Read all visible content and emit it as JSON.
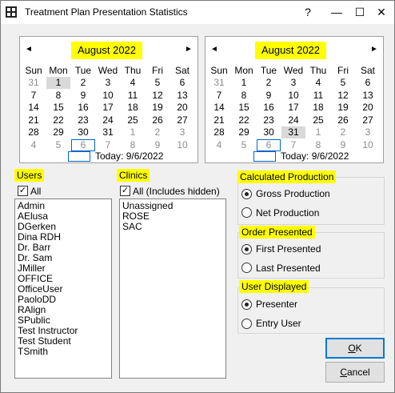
{
  "window": {
    "title": "Treatment Plan Presentation Statistics",
    "help": "?",
    "minimize": "—",
    "maximize": "☐",
    "close": "✕"
  },
  "calendars": [
    {
      "prev": "◄",
      "next": "►",
      "month_label": "August 2022",
      "days_of_week": [
        "Sun",
        "Mon",
        "Tue",
        "Wed",
        "Thu",
        "Fri",
        "Sat"
      ],
      "weeks": [
        [
          "31",
          "1",
          "2",
          "3",
          "4",
          "5",
          "6"
        ],
        [
          "7",
          "8",
          "9",
          "10",
          "11",
          "12",
          "13"
        ],
        [
          "14",
          "15",
          "16",
          "17",
          "18",
          "19",
          "20"
        ],
        [
          "21",
          "22",
          "23",
          "24",
          "25",
          "26",
          "27"
        ],
        [
          "28",
          "29",
          "30",
          "31",
          "1",
          "2",
          "3"
        ],
        [
          "4",
          "5",
          "6",
          "7",
          "8",
          "9",
          "10"
        ]
      ],
      "today_label": "Today: 9/6/2022"
    },
    {
      "prev": "◄",
      "next": "►",
      "month_label": "August 2022",
      "days_of_week": [
        "Sun",
        "Mon",
        "Tue",
        "Wed",
        "Thu",
        "Fri",
        "Sat"
      ],
      "weeks": [
        [
          "31",
          "1",
          "2",
          "3",
          "4",
          "5",
          "6"
        ],
        [
          "7",
          "8",
          "9",
          "10",
          "11",
          "12",
          "13"
        ],
        [
          "14",
          "15",
          "16",
          "17",
          "18",
          "19",
          "20"
        ],
        [
          "21",
          "22",
          "23",
          "24",
          "25",
          "26",
          "27"
        ],
        [
          "28",
          "29",
          "30",
          "31",
          "1",
          "2",
          "3"
        ],
        [
          "4",
          "5",
          "6",
          "7",
          "8",
          "9",
          "10"
        ]
      ],
      "today_label": "Today: 9/6/2022"
    }
  ],
  "users": {
    "label": "Users",
    "all_label": "All",
    "items": [
      "Admin",
      "AElusa",
      "DGerken",
      "Dina RDH",
      "Dr. Barr",
      "Dr. Sam",
      "JMiller",
      "OFFICE",
      "OfficeUser",
      "PaoloDD",
      "RAlign",
      "SPublic",
      "Test Instructor",
      "Test Student",
      "TSmith"
    ]
  },
  "clinics": {
    "label": "Clinics",
    "all_label": "All (Includes hidden)",
    "items": [
      "Unassigned",
      "ROSE",
      "SAC"
    ]
  },
  "production": {
    "label": "Calculated Production",
    "options": [
      "Gross Production",
      "Net Production"
    ],
    "selected": "Gross Production"
  },
  "order": {
    "label": "Order Presented",
    "options": [
      "First Presented",
      "Last Presented"
    ],
    "selected": "First Presented"
  },
  "user_displayed": {
    "label": "User Displayed",
    "options": [
      "Presenter",
      "Entry User"
    ],
    "selected": "Presenter"
  },
  "buttons": {
    "ok": "OK",
    "cancel": "Cancel"
  },
  "colors": {
    "highlight": "#ffff00",
    "today_outline": "#0066cc",
    "selected_day": "#d9d9d9"
  }
}
